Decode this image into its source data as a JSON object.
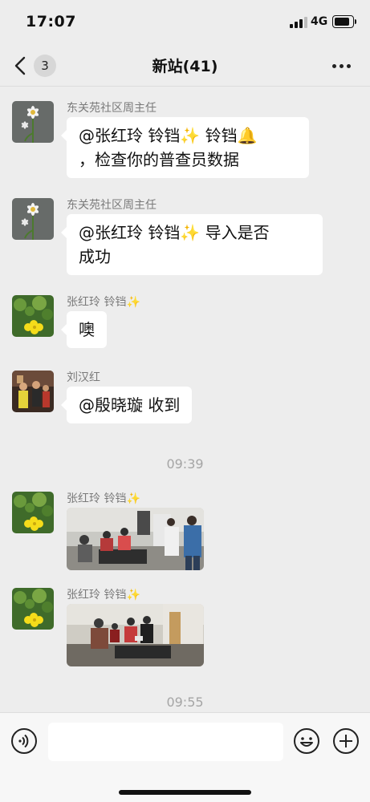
{
  "status_bar": {
    "time": "17:07",
    "network": "4G",
    "icons": [
      "signal-icon",
      "battery-icon"
    ]
  },
  "nav": {
    "back_count": "3",
    "title": "新站(41)",
    "icons": [
      "chevron-left-icon",
      "more-icon"
    ]
  },
  "messages": [
    {
      "sender": "东关苑社区周主任",
      "line1": "@张红玲   铃铛✨ 铃铛🔔",
      "line2": "，检查你的普查员数据"
    },
    {
      "sender": "东关苑社区周主任",
      "line1": "@张红玲   铃铛✨ 导入是否",
      "line2": "成功"
    },
    {
      "sender": "张红玲   铃铛✨",
      "text": "噢"
    },
    {
      "sender": "刘汉红",
      "text": "@殷晓璇 收到"
    },
    {
      "sender": "张红玲   铃铛✨",
      "image": "photo-of-people-in-office"
    },
    {
      "sender": "张红玲   铃铛✨",
      "image": "photo-of-people-in-room"
    }
  ],
  "timestamps": [
    "09:39",
    "09:55"
  ],
  "input_bar": {
    "placeholder": "",
    "icons": [
      "voice-icon",
      "emoji-icon",
      "plus-icon"
    ]
  },
  "colors": {
    "background": "#ededed",
    "bubble": "#ffffff",
    "meta_text": "#7a7a7a"
  }
}
